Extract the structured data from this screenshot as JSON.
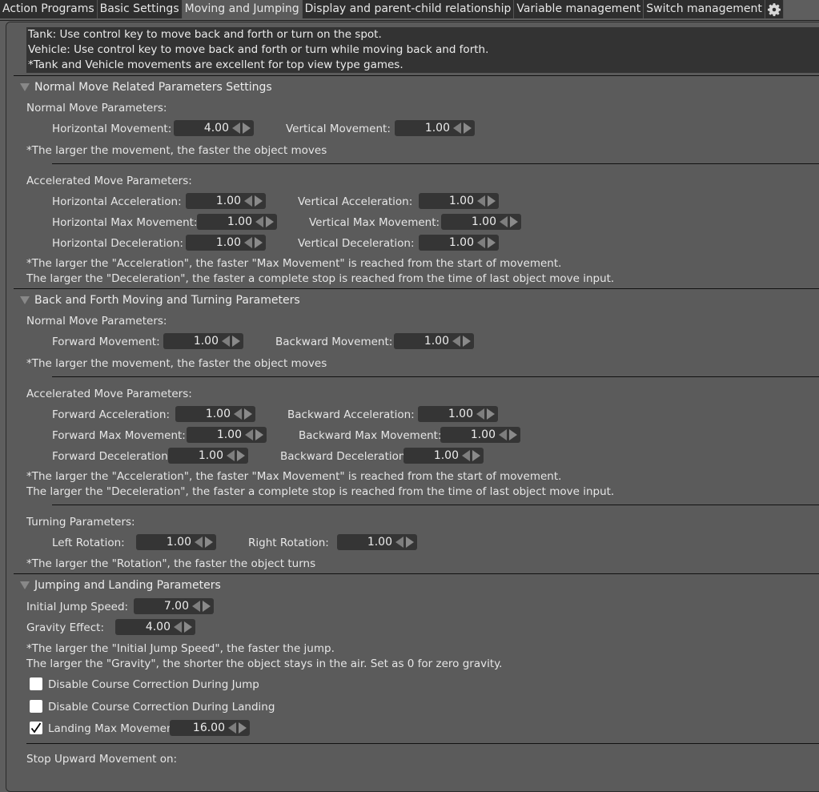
{
  "tabs": [
    {
      "label": "Action Programs",
      "active": false
    },
    {
      "label": "Basic Settings",
      "active": false
    },
    {
      "label": "Moving and Jumping",
      "active": true
    },
    {
      "label": "Display and parent-child relationship",
      "active": false
    },
    {
      "label": "Variable management",
      "active": false
    },
    {
      "label": "Switch management",
      "active": false
    }
  ],
  "settings_icon": "gear-icon",
  "info": {
    "line1": "Tank: Use control key to move back and forth or turn on the spot.",
    "line2": "Vehicle: Use control key to move back and forth or turn while moving back and forth.",
    "line3": "*Tank and Vehicle movements are excellent for top view type games."
  },
  "normal_section": {
    "title": "Normal Move Related Parameters Settings",
    "normal_heading": "Normal Move Parameters:",
    "horizontal_movement": {
      "label": "Horizontal Movement:",
      "value": "4.00"
    },
    "vertical_movement": {
      "label": "Vertical Movement:",
      "value": "1.00"
    },
    "normal_note": "*The larger the movement, the faster the object moves",
    "accel_heading": "Accelerated Move Parameters:",
    "horizontal_acceleration": {
      "label": "Horizontal Acceleration:",
      "value": "1.00"
    },
    "vertical_acceleration": {
      "label": "Vertical Acceleration:",
      "value": "1.00"
    },
    "horizontal_max": {
      "label": "Horizontal Max Movement:",
      "value": "1.00"
    },
    "vertical_max": {
      "label": "Vertical Max Movement:",
      "value": "1.00"
    },
    "horizontal_deceleration": {
      "label": "Horizontal Deceleration:",
      "value": "1.00"
    },
    "vertical_deceleration": {
      "label": "Vertical Deceleration:",
      "value": "1.00"
    },
    "accel_note1": "*The larger the \"Acceleration\", the faster \"Max Movement\" is reached from the start of movement.",
    "accel_note2": "The larger the \"Deceleration\", the faster a complete stop is reached from the time of last object move input."
  },
  "backforth_section": {
    "title": "Back and Forth Moving and Turning Parameters",
    "normal_heading": "Normal Move Parameters:",
    "forward_movement": {
      "label": "Forward Movement:",
      "value": "1.00"
    },
    "backward_movement": {
      "label": "Backward Movement:",
      "value": "1.00"
    },
    "normal_note": "*The larger the movement, the faster the object moves",
    "accel_heading": "Accelerated Move Parameters:",
    "forward_acceleration": {
      "label": "Forward Acceleration:",
      "value": "1.00"
    },
    "backward_acceleration": {
      "label": "Backward Acceleration:",
      "value": "1.00"
    },
    "forward_max": {
      "label": "Forward Max Movement:",
      "value": "1.00"
    },
    "backward_max": {
      "label": "Backward Max Movement:",
      "value": "1.00"
    },
    "forward_deceleration": {
      "label": "Forward Deceleration",
      "value": "1.00"
    },
    "backward_deceleration": {
      "label": "Backward Deceleration",
      "value": "1.00"
    },
    "accel_note1": "*The larger the \"Acceleration\", the faster \"Max Movement\" is reached from the start of movement.",
    "accel_note2": "The larger the \"Deceleration\", the faster a complete stop is reached from the time of last object move input.",
    "turning_heading": "Turning Parameters:",
    "left_rotation": {
      "label": "Left Rotation:",
      "value": "1.00"
    },
    "right_rotation": {
      "label": "Right Rotation:",
      "value": "1.00"
    },
    "turning_note": "*The larger the \"Rotation\", the faster the object turns"
  },
  "jump_section": {
    "title": "Jumping and Landing Parameters",
    "initial_jump_speed": {
      "label": "Initial Jump Speed:",
      "value": "7.00"
    },
    "gravity_effect": {
      "label": "Gravity Effect:",
      "value": "4.00"
    },
    "note1": "*The larger the \"Initial Jump Speed\", the faster the jump.",
    "note2": "The larger the \"Gravity\", the shorter the object stays in the air. Set as 0 for zero gravity.",
    "disable_jump_correction": {
      "label": "Disable Course Correction During Jump",
      "checked": false
    },
    "disable_landing_correction": {
      "label": "Disable Course Correction During Landing",
      "checked": false
    },
    "landing_max_movement": {
      "label": "Landing Max Movement",
      "checked": true,
      "value": "16.00"
    },
    "stop_upward_heading": "Stop Upward Movement on:"
  }
}
